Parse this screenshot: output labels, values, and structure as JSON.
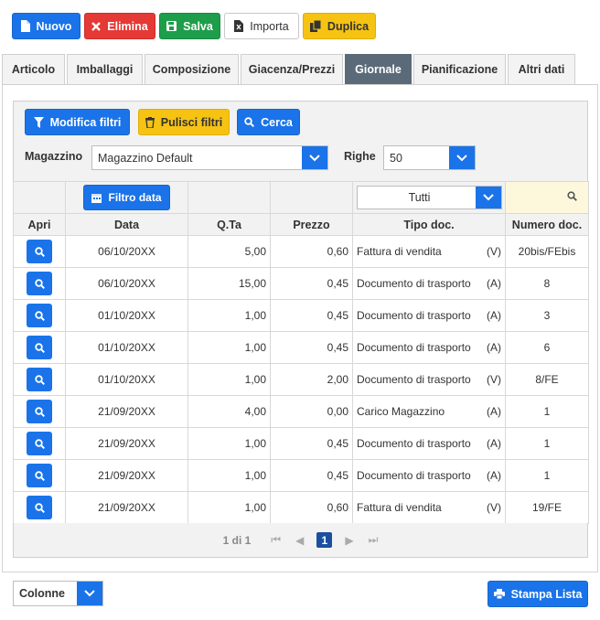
{
  "toolbar": {
    "nuovo": "Nuovo",
    "elimina": "Elimina",
    "salva": "Salva",
    "importa": "Importa",
    "duplica": "Duplica"
  },
  "tabs": [
    "Articolo",
    "Imballaggi",
    "Composizione",
    "Giacenza/Prezzi",
    "Giornale",
    "Pianificazione",
    "Altri dati"
  ],
  "active_tab": "Giornale",
  "filters": {
    "modifica_filtri": "Modifica filtri",
    "pulisci_filtri": "Pulisci filtri",
    "cerca": "Cerca",
    "magazzino_label": "Magazzino",
    "magazzino_value": "Magazzino Default",
    "righe_label": "Righe",
    "righe_value": "50",
    "filtro_data": "Filtro data",
    "tipo_filter_value": "Tutti"
  },
  "columns": [
    "Apri",
    "Data",
    "Q.Ta",
    "Prezzo",
    "Tipo doc.",
    "Numero doc."
  ],
  "rows": [
    {
      "data": "06/10/20XX",
      "qta": "5,00",
      "prezzo": "0,60",
      "tipo": "Fattura di vendita",
      "verso": "(V)",
      "numero": "20bis/FEbis"
    },
    {
      "data": "06/10/20XX",
      "qta": "15,00",
      "prezzo": "0,45",
      "tipo": "Documento di trasporto",
      "verso": "(A)",
      "numero": "8"
    },
    {
      "data": "01/10/20XX",
      "qta": "1,00",
      "prezzo": "0,45",
      "tipo": "Documento di trasporto",
      "verso": "(A)",
      "numero": "3"
    },
    {
      "data": "01/10/20XX",
      "qta": "1,00",
      "prezzo": "0,45",
      "tipo": "Documento di trasporto",
      "verso": "(A)",
      "numero": "6"
    },
    {
      "data": "01/10/20XX",
      "qta": "1,00",
      "prezzo": "2,00",
      "tipo": "Documento di trasporto",
      "verso": "(V)",
      "numero": "8/FE"
    },
    {
      "data": "21/09/20XX",
      "qta": "4,00",
      "prezzo": "0,00",
      "tipo": "Carico Magazzino",
      "verso": "(A)",
      "numero": "1"
    },
    {
      "data": "21/09/20XX",
      "qta": "1,00",
      "prezzo": "0,45",
      "tipo": "Documento di trasporto",
      "verso": "(A)",
      "numero": "1"
    },
    {
      "data": "21/09/20XX",
      "qta": "1,00",
      "prezzo": "0,45",
      "tipo": "Documento di trasporto",
      "verso": "(A)",
      "numero": "1"
    },
    {
      "data": "21/09/20XX",
      "qta": "1,00",
      "prezzo": "0,60",
      "tipo": "Fattura di vendita",
      "verso": "(V)",
      "numero": "19/FE"
    }
  ],
  "pager": {
    "info": "1 di 1",
    "current": "1"
  },
  "footer": {
    "colonne": "Colonne",
    "stampa": "Stampa Lista"
  },
  "colors": {
    "primary": "#1a73e8",
    "danger": "#e53935",
    "success": "#1e9e4a",
    "warning": "#f6c313",
    "tab_active": "#5a6a78"
  }
}
